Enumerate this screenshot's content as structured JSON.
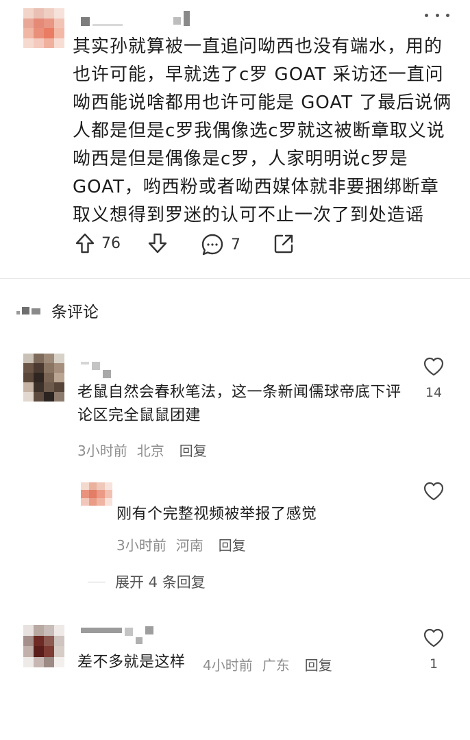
{
  "post": {
    "body": "其实孙就算被一直追问呦西也没有端水，用的也许可能，早就选了c罗 GOAT 采访还一直问呦西能说啥都用也许可能是 GOAT 了最后说俩人都是但是c罗我偶像选c罗就这被断章取义说呦西是但是偶像是c罗，人家明明说c罗是GOAT，哟西粉或者呦西媒体就非要捆绑断章取义想得到罗迷的认可不止一次了到处造谣",
    "upvote_count": "76",
    "comment_count": "7",
    "icons": {
      "more": "more-horizontal-icon",
      "upvote": "arrow-up-icon",
      "downvote": "arrow-down-icon",
      "comment": "comment-bubble-icon",
      "share": "share-icon"
    }
  },
  "comments_section": {
    "header_label": "条评论"
  },
  "comments": [
    {
      "text": "老鼠自然会春秋笔法，这一条新闻儒球帝底下评论区完全鼠鼠团建",
      "time": "3小时前",
      "location": "北京",
      "reply_label": "回复",
      "like_count": "14"
    },
    {
      "text": "刚有个完整视频被举报了感觉",
      "time": "3小时前",
      "location": "河南",
      "reply_label": "回复",
      "like_count": ""
    },
    {
      "text": "差不多就是这样",
      "time": "4小时前",
      "location": "广东",
      "reply_label": "回复",
      "like_count": "1"
    }
  ],
  "expand_replies_label": "展开 4 条回复",
  "colors": {
    "text_primary": "#1c1c1c",
    "text_meta": "#8d8d8d",
    "divider": "#e8e8e8"
  }
}
